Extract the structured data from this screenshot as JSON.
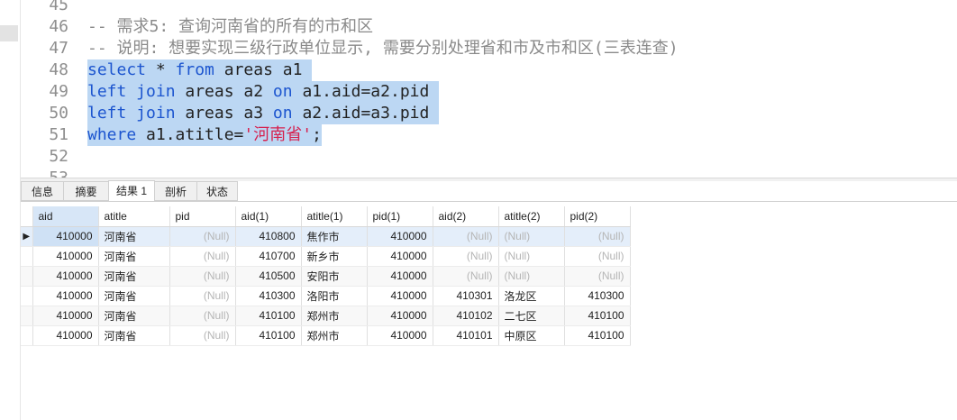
{
  "editor": {
    "lines": [
      {
        "num": "45",
        "segments": []
      },
      {
        "num": "46",
        "segments": [
          {
            "t": "-- 需求5: 查询河南省的所有的市和区",
            "c": "cm"
          }
        ]
      },
      {
        "num": "47",
        "segments": [
          {
            "t": "-- 说明: 想要实现三级行政单位显示, 需要分别处理省和市及市和区(三表连查)",
            "c": "cm"
          }
        ]
      },
      {
        "num": "48",
        "selected": true,
        "segments": [
          {
            "t": "select",
            "c": "kw"
          },
          {
            "t": " * ",
            "c": "tx"
          },
          {
            "t": "from",
            "c": "kw"
          },
          {
            "t": " areas a1 ",
            "c": "tx"
          }
        ]
      },
      {
        "num": "49",
        "selected": true,
        "segments": [
          {
            "t": "left join",
            "c": "kw"
          },
          {
            "t": " areas a2 ",
            "c": "tx"
          },
          {
            "t": "on",
            "c": "kw"
          },
          {
            "t": " a1.aid=a2.pid ",
            "c": "tx"
          }
        ]
      },
      {
        "num": "50",
        "selected": true,
        "segments": [
          {
            "t": "left join",
            "c": "kw"
          },
          {
            "t": " areas a3 ",
            "c": "tx"
          },
          {
            "t": "on",
            "c": "kw"
          },
          {
            "t": " a2.aid=a3.pid ",
            "c": "tx"
          }
        ]
      },
      {
        "num": "51",
        "selected": true,
        "segments": [
          {
            "t": "where",
            "c": "kw"
          },
          {
            "t": " a1.atitle=",
            "c": "tx"
          },
          {
            "t": "'河南省'",
            "c": "str"
          },
          {
            "t": ";",
            "c": "tx"
          }
        ]
      },
      {
        "num": "52",
        "segments": []
      },
      {
        "num": "53",
        "segments": []
      }
    ]
  },
  "tabs": [
    {
      "label": "信息",
      "active": false
    },
    {
      "label": "摘要",
      "active": false
    },
    {
      "label": "结果 1",
      "active": true
    },
    {
      "label": "剖析",
      "active": false
    },
    {
      "label": "状态",
      "active": false
    }
  ],
  "grid": {
    "columns": [
      "aid",
      "atitle",
      "pid",
      "aid(1)",
      "atitle(1)",
      "pid(1)",
      "aid(2)",
      "atitle(2)",
      "pid(2)"
    ],
    "rows": [
      [
        "410000",
        "河南省",
        "(Null)",
        "410800",
        "焦作市",
        "410000",
        "(Null)",
        "(Null)",
        "(Null)"
      ],
      [
        "410000",
        "河南省",
        "(Null)",
        "410700",
        "新乡市",
        "410000",
        "(Null)",
        "(Null)",
        "(Null)"
      ],
      [
        "410000",
        "河南省",
        "(Null)",
        "410500",
        "安阳市",
        "410000",
        "(Null)",
        "(Null)",
        "(Null)"
      ],
      [
        "410000",
        "河南省",
        "(Null)",
        "410300",
        "洛阳市",
        "410000",
        "410301",
        "洛龙区",
        "410300"
      ],
      [
        "410000",
        "河南省",
        "(Null)",
        "410100",
        "郑州市",
        "410000",
        "410102",
        "二七区",
        "410100"
      ],
      [
        "410000",
        "河南省",
        "(Null)",
        "410100",
        "郑州市",
        "410000",
        "410101",
        "中原区",
        "410100"
      ]
    ],
    "row_indicator": "▶"
  }
}
